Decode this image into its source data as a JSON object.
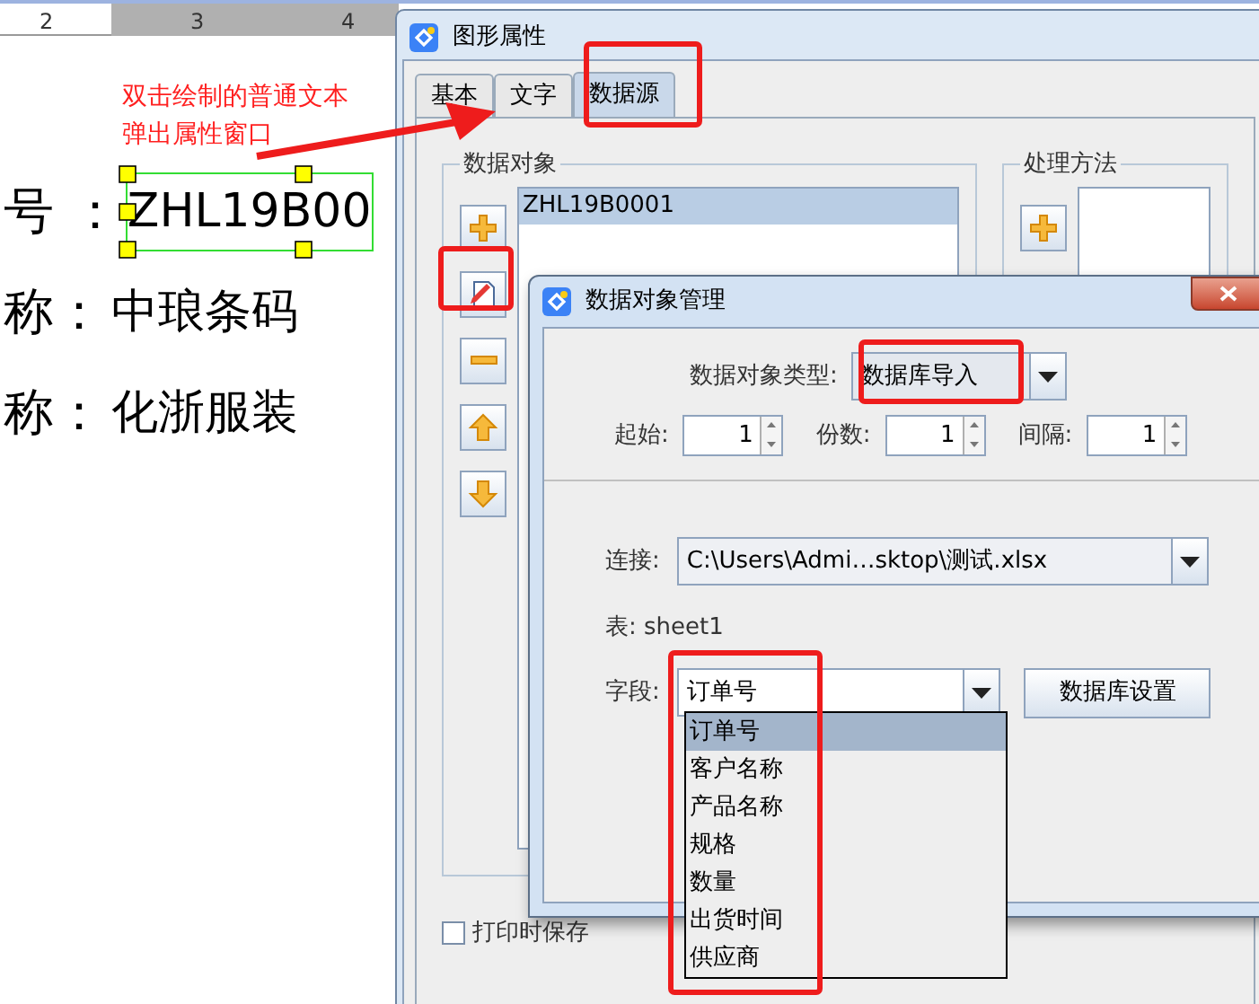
{
  "canvas": {
    "ruler_marks": [
      "2",
      "3",
      "4"
    ],
    "annotation": [
      "双击绘制的普通文本",
      "弹出属性窗口"
    ],
    "lines": [
      {
        "label": "号 ：",
        "value": "ZHL19B00",
        "selected": true
      },
      {
        "label": "称：",
        "value": "中琅条码",
        "selected": false
      },
      {
        "label": "称：",
        "value": "化浙服装",
        "selected": false
      }
    ]
  },
  "properties_window": {
    "title": "图形属性",
    "tabs": [
      {
        "label": "基本",
        "selected": false
      },
      {
        "label": "文字",
        "selected": false
      },
      {
        "label": "数据源",
        "selected": true
      }
    ],
    "data_objects": {
      "title": "数据对象",
      "items": [
        {
          "label": "ZHL19B0001",
          "selected": true
        }
      ]
    },
    "processing": {
      "title": "处理方法"
    },
    "save_on_print": {
      "label": "打印时保存",
      "checked": false
    }
  },
  "object_dialog": {
    "title": "数据对象管理",
    "type": {
      "label": "数据对象类型:",
      "value": "数据库导入"
    },
    "spinners": [
      {
        "label": "起始:",
        "value": "1"
      },
      {
        "label": "份数:",
        "value": "1"
      },
      {
        "label": "间隔:",
        "value": "1"
      }
    ],
    "connection": {
      "label": "连接:",
      "value": "C:\\Users\\Admi…sktop\\测试.xlsx"
    },
    "table": "表: sheet1",
    "field": {
      "label": "字段:",
      "value": "订单号",
      "options": [
        {
          "label": "订单号",
          "selected": true
        },
        {
          "label": "客户名称",
          "selected": false
        },
        {
          "label": "产品名称",
          "selected": false
        },
        {
          "label": "规格",
          "selected": false
        },
        {
          "label": "数量",
          "selected": false
        },
        {
          "label": "出货时间",
          "selected": false
        },
        {
          "label": "供应商",
          "selected": false
        }
      ]
    },
    "settings_button": "数据库设置"
  }
}
